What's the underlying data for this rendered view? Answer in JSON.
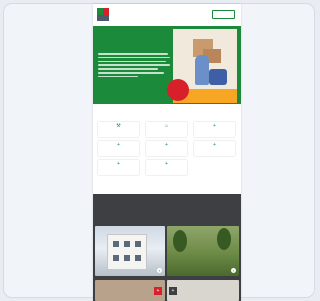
{
  "header": {
    "brand": "",
    "login_label": ""
  },
  "hero": {
    "kicker": "",
    "title": "",
    "badge": ""
  },
  "services": {
    "items": [
      {
        "label": "",
        "icon": "tool-icon"
      },
      {
        "label": "",
        "icon": "house-icon"
      },
      {
        "label": "",
        "icon": "plus-icon"
      },
      {
        "label": "",
        "icon": "plus-icon"
      },
      {
        "label": "",
        "icon": "plus-icon"
      },
      {
        "label": "",
        "icon": "plus-icon"
      },
      {
        "label": "",
        "icon": "plus-icon"
      },
      {
        "label": "",
        "icon": "plus-icon"
      }
    ]
  },
  "featured": {
    "kicker": "",
    "title": "",
    "cards": [
      {
        "caption": ""
      },
      {
        "caption": ""
      }
    ]
  },
  "colors": {
    "brand_green": "#1b8a3a",
    "brand_red": "#d8202a",
    "dark_section": "#3d3f42",
    "background": "#f1f4f8"
  }
}
